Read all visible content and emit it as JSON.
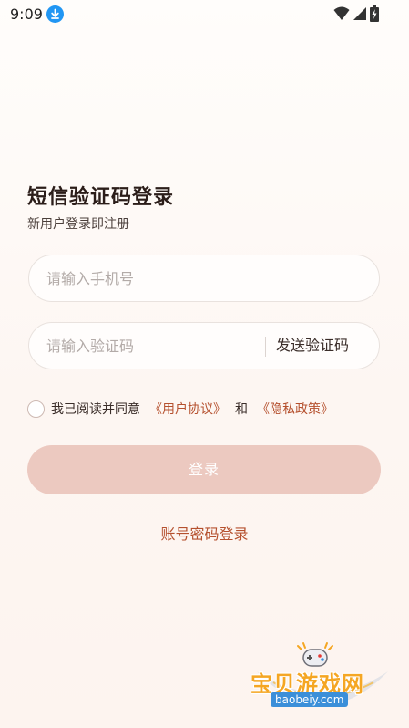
{
  "status_bar": {
    "time": "9:09",
    "icons": [
      "download-icon",
      "wifi-icon",
      "signal-icon",
      "battery-charging-icon"
    ]
  },
  "login": {
    "title": "短信验证码登录",
    "subtitle": "新用户登录即注册",
    "phone_placeholder": "请输入手机号",
    "phone_value": "",
    "code_placeholder": "请输入验证码",
    "code_value": "",
    "send_code_label": "发送验证码",
    "agreement": {
      "checked": false,
      "prefix": "我已阅读并同意",
      "user_agreement": "《用户协议》",
      "conjunction": "和",
      "privacy_policy": "《隐私政策》"
    },
    "login_button": "登录",
    "password_login": "账号密码登录"
  },
  "watermark": {
    "title": "宝贝游戏网",
    "url": "baobeiy.com"
  },
  "colors": {
    "accent": "#b5502e",
    "login_button_disabled": "#ecc9c0",
    "watermark_orange": "#f5a623",
    "watermark_blue": "#3b8fd9"
  }
}
